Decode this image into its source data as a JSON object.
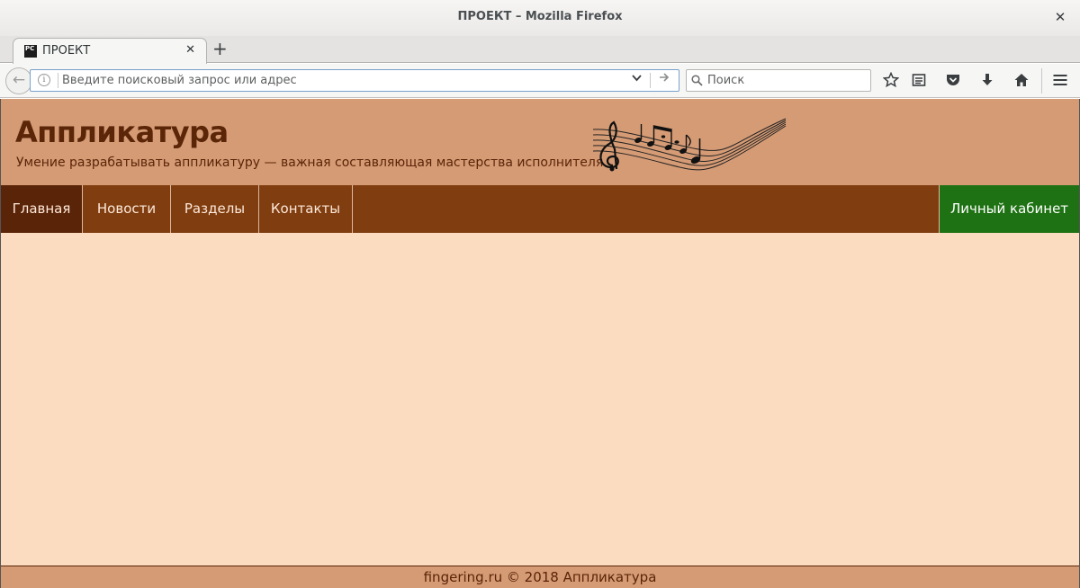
{
  "window": {
    "title": "ПРОЕКТ – Mozilla Firefox",
    "close_glyph": "✕"
  },
  "tabs": [
    {
      "label": "ПРОЕКТ",
      "favicon_text": "PC",
      "close_glyph": "✕"
    }
  ],
  "new_tab_glyph": "+",
  "toolbar": {
    "back_glyph": "←",
    "url_placeholder": "Введите поисковый запрос или адрес",
    "url_value": "",
    "url_dropdown_glyph": "⌄",
    "go_glyph": "→",
    "search_placeholder": "Поиск",
    "icons": [
      "bookmark-star-icon",
      "reading-list-icon",
      "pocket-icon",
      "download-icon",
      "home-icon",
      "menu-icon"
    ]
  },
  "site": {
    "title": "Аппликатура",
    "tagline": "Умение разрабатывать аппликатуру — важная составляющая мастерства исполнителя",
    "logo": "music-notes-logo",
    "nav": [
      {
        "label": "Главная",
        "active": true
      },
      {
        "label": "Новости",
        "active": false
      },
      {
        "label": "Разделы",
        "active": false
      },
      {
        "label": "Контакты",
        "active": false
      }
    ],
    "cabinet_label": "Личный кабинет",
    "footer": "fingering.ru © 2018 Аппликатура"
  },
  "colors": {
    "header_bg": "#d59b75",
    "nav_bg": "#7f3d10",
    "nav_active_bg": "#5a2408",
    "cabinet_bg": "#1e7213",
    "page_bg": "#fbdcc0",
    "title_color": "#5b2508"
  }
}
